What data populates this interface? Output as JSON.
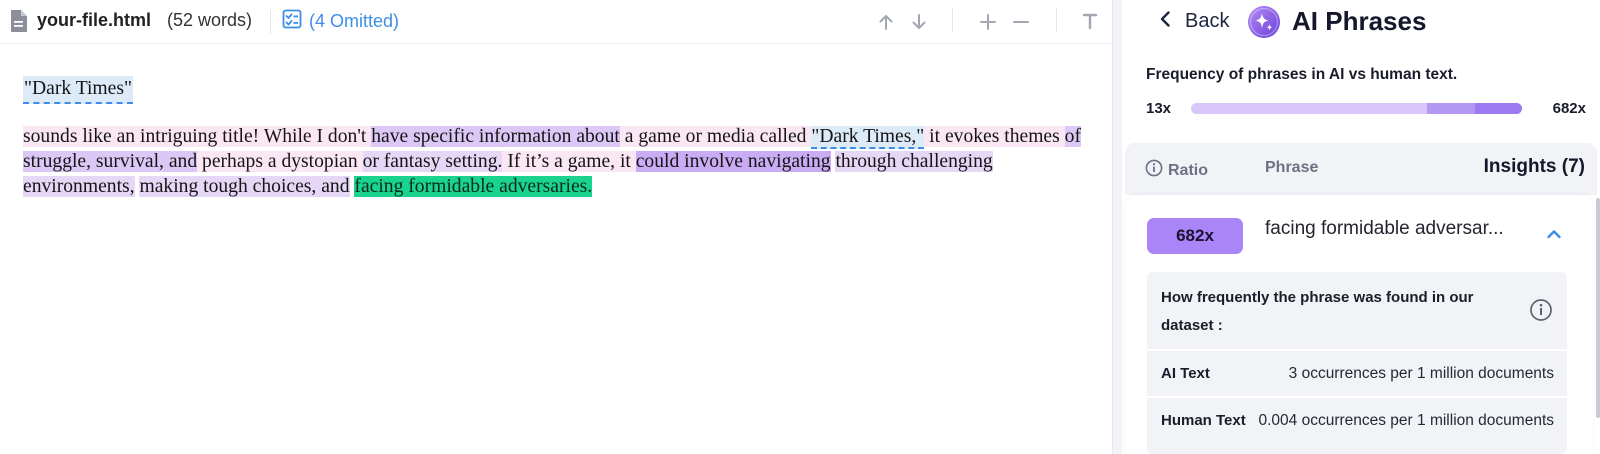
{
  "editor": {
    "file_name": "your-file.html",
    "word_count": "(52 words)",
    "omitted_label": "(4 Omitted)",
    "toolbar_icons": [
      "arrow-up-icon",
      "arrow-down-icon",
      "plus-icon",
      "minus-icon",
      "text-format-icon"
    ]
  },
  "document": {
    "title": "\"Dark Times\"",
    "segments": [
      {
        "text": "sounds like an intriguing title! While I don't ",
        "style": "pink"
      },
      {
        "text": "have specific information about",
        "style": "lav2"
      },
      {
        "text": " a game or media called ",
        "style": "pink"
      },
      {
        "text": "\"Dark Times,\"",
        "style": "blue"
      },
      {
        "text": " it evokes themes ",
        "style": "pink"
      },
      {
        "text": "of struggle, survival, and",
        "style": "lav2"
      },
      {
        "text": " perhaps a dystopian ",
        "style": "pink"
      },
      {
        "text": "or fantasy setting.",
        "style": "lav"
      },
      {
        "text": " If it’s a game, it ",
        "style": "pink"
      },
      {
        "text": "could involve navigating",
        "style": "pur"
      },
      {
        "text": " ",
        "style": "none"
      },
      {
        "text": "through challenging environments,",
        "style": "lav"
      },
      {
        "text": " ",
        "style": "none"
      },
      {
        "text": "making tough choices, and",
        "style": "lav"
      },
      {
        "text": " ",
        "style": "none"
      },
      {
        "text": "facing formidable adversaries.",
        "style": "green"
      }
    ]
  },
  "panel": {
    "back_label": "Back",
    "title": "AI Phrases",
    "frequency": {
      "title": "Frequency of phrases in AI vs human text.",
      "min_label": "13x",
      "max_label": "682x"
    },
    "columns": {
      "ratio": "Ratio",
      "phrase": "Phrase",
      "insights": "Insights (7)"
    },
    "active_phrase": {
      "ratio": "682x",
      "phrase": "facing formidable adversar...",
      "question": "How frequently the phrase was found in our dataset :",
      "stats": [
        {
          "label": "AI Text",
          "value": "3 occurrences per 1 million documents"
        },
        {
          "label": "Human Text",
          "value": "0.004 occurrences per 1 million documents"
        }
      ]
    }
  },
  "colors": {
    "accent_blue": "#3d8ee8",
    "ratio_badge": "#a985f7",
    "highlight_green": "#19d38f",
    "highlight_purple": "#c9acf3"
  }
}
